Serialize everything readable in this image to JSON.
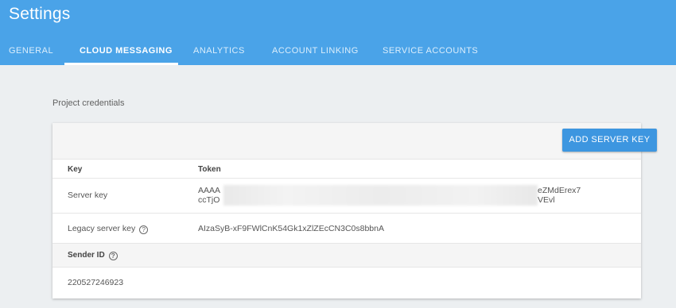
{
  "header": {
    "title": "Settings",
    "tabs": [
      {
        "label": "GENERAL",
        "active": false
      },
      {
        "label": "CLOUD MESSAGING",
        "active": true
      },
      {
        "label": "ANALYTICS",
        "active": false
      },
      {
        "label": "ACCOUNT LINKING",
        "active": false
      },
      {
        "label": "SERVICE ACCOUNTS",
        "active": false
      }
    ]
  },
  "main": {
    "section_label": "Project credentials",
    "add_button_label": "ADD SERVER KEY",
    "table": {
      "columns": [
        "Key",
        "Token"
      ],
      "server_key": {
        "label": "Server key",
        "token_start_line1": "AAAA",
        "token_start_line2": "ccTjO",
        "token_end_line1": "eZMdErex7",
        "token_end_line2": "VEvl"
      },
      "legacy_key": {
        "label": "Legacy server key",
        "help_glyph": "?",
        "token": "AIzaSyB-xF9FWlCnK54Gk1xZlZEcCN3C0s8bbnA"
      },
      "sender": {
        "label": "Sender ID",
        "help_glyph": "?",
        "value": "220527246923"
      }
    }
  },
  "colors": {
    "header_bg": "#4aa3e8",
    "button_bg": "#3d96e0",
    "page_bg": "#eceff1"
  }
}
